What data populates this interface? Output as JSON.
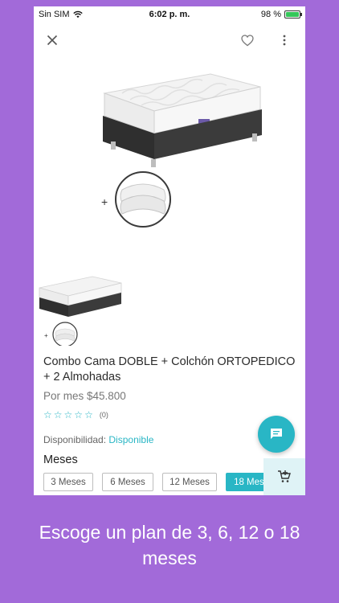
{
  "status_bar": {
    "carrier": "Sin SIM",
    "time": "6:02 p. m.",
    "battery": "98 %",
    "battery_level": 0.98,
    "icons": [
      "wifi-icon",
      "battery-icon"
    ]
  },
  "nav": {
    "icons": [
      "close-icon",
      "heart-icon",
      "more-vertical-icon"
    ]
  },
  "product": {
    "title": "Combo Cama DOBLE + Colchón ORTOPEDICO + 2 Almohadas",
    "price": "Por mes $45.800",
    "rating_value": 0,
    "rating_max": 5,
    "rating_count": "(0)",
    "availability_label": "Disponibilidad:",
    "availability_value": "Disponible",
    "plus_sign": "+"
  },
  "months": {
    "title": "Meses",
    "options": [
      "3 Meses",
      "6 Meses",
      "12 Meses",
      "18 Meses"
    ],
    "selected": "18 Meses"
  },
  "caption": {
    "line1": "Escoge un plan de 3, 6, 12 o 18",
    "line2": "meses"
  },
  "colors": {
    "background": "#a26ad9",
    "accent": "#29b6c5",
    "text": "#2b2b2b"
  }
}
